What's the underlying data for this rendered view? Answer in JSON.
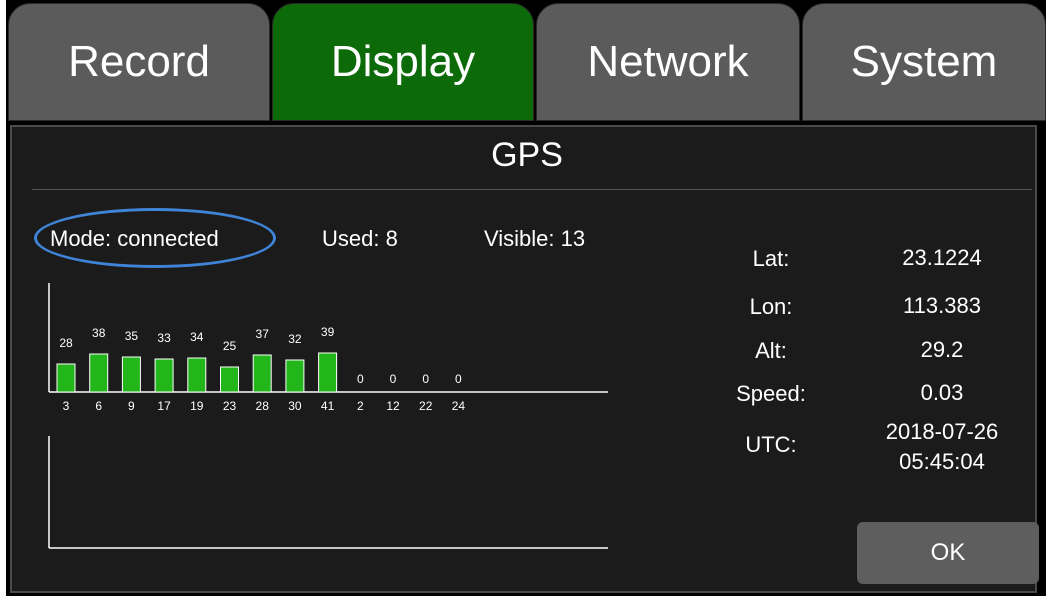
{
  "tabs": [
    {
      "label": "Record"
    },
    {
      "label": "Display",
      "active": true
    },
    {
      "label": "Network"
    },
    {
      "label": "System"
    }
  ],
  "title": "GPS",
  "status": {
    "mode": "Mode: connected",
    "used": "Used: 8",
    "visible": "Visible: 13"
  },
  "chart_data": {
    "type": "bar",
    "categories": [
      "3",
      "6",
      "9",
      "17",
      "19",
      "23",
      "28",
      "30",
      "41",
      "2",
      "12",
      "22",
      "24"
    ],
    "values": [
      28,
      38,
      35,
      33,
      34,
      25,
      37,
      32,
      39,
      0,
      0,
      0,
      0
    ],
    "ylim": [
      0,
      40
    ],
    "bar_color": "#22b61a"
  },
  "info": {
    "lat": {
      "label": "Lat:",
      "value": "23.1224"
    },
    "lon": {
      "label": "Lon:",
      "value": "113.383"
    },
    "alt": {
      "label": "Alt:",
      "value": "29.2"
    },
    "speed": {
      "label": "Speed:",
      "value": "0.03"
    },
    "utc": {
      "label": "UTC:",
      "date": "2018-07-26",
      "time": "05:45:04"
    }
  },
  "ok_label": "OK",
  "colors": {
    "tab_active": "#0c6b08",
    "tab_inactive": "#5b5b5b",
    "highlight": "#3f84d6"
  }
}
